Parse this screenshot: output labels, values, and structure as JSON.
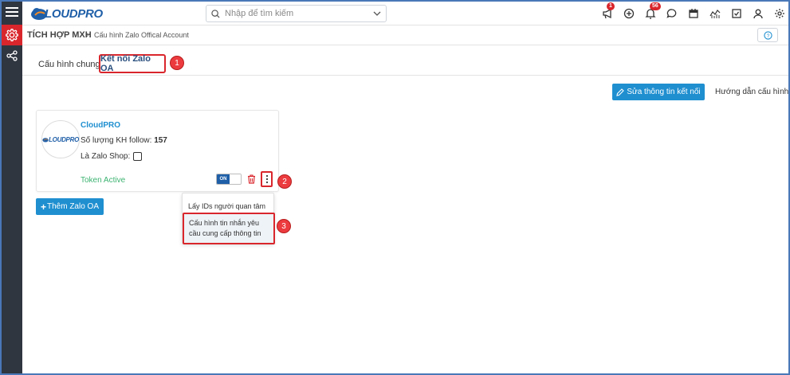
{
  "app": {
    "logo_text": "LOUDPRO",
    "brand_color": "#1f5fa8"
  },
  "search": {
    "placeholder": "Nhập để tìm kiếm"
  },
  "topbar": {
    "icons": [
      "megaphone-icon",
      "plus-circle-icon",
      "bell-icon",
      "chat-icon",
      "calendar-icon",
      "chart-icon",
      "task-icon",
      "user-icon",
      "settings-icon"
    ],
    "megaphone_badge": "1",
    "bell_badge": "56"
  },
  "breadcrumb": {
    "main": "TÍCH HỢP MXH",
    "separator": "›",
    "sub": "Cấu hình Zalo Offical Account"
  },
  "tabs": {
    "general": "Cấu hình chung",
    "zalo_oa": "Kết nối Zalo OA"
  },
  "actions": {
    "edit_connection": "Sửa thông tin kết nối",
    "guide": "Hướng dẫn cấu hình"
  },
  "oa_card": {
    "avatar_text": "LOUDPRO",
    "name": "CloudPRO",
    "follow_label": "Số lượng KH follow: ",
    "follow_count": "157",
    "zalo_shop_label": "Là Zalo Shop:",
    "token_status": "Token Active",
    "toggle_label": "ON"
  },
  "add_button": "Thêm Zalo OA",
  "dropdown_menu": {
    "item_1": "Lấy IDs người quan tâm",
    "item_2": "Cấu hình tin nhắn yêu cầu cung cấp thông tin"
  },
  "step_markers": [
    "1",
    "2",
    "3"
  ]
}
